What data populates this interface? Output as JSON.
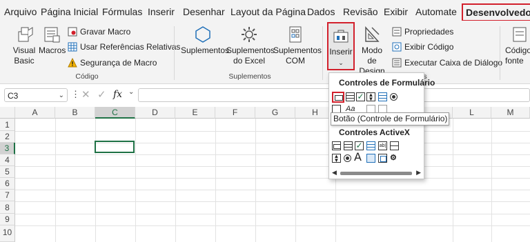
{
  "tabs": [
    "Arquivo",
    "Página Inicial",
    "Fórmulas",
    "Inserir",
    "Desenhar",
    "Layout da Página",
    "Dados",
    "Revisão",
    "Exibir",
    "Automate",
    "Desenvolvedor"
  ],
  "ribbon": {
    "codigo": {
      "visual_basic": "Visual Basic",
      "macros": "Macros",
      "gravar_macro": "Gravar Macro",
      "referencias": "Usar Referências Relativas",
      "seguranca": "Segurança de Macro",
      "group_label": "Código"
    },
    "suplementos": {
      "suplementos": "Suplementos",
      "excel": "Suplementos do Excel",
      "com": "Suplementos COM",
      "group_label": "Suplementos"
    },
    "controles": {
      "inserir": "Inserir",
      "modo_design": "Modo de Design",
      "propriedades": "Propriedades",
      "exibir_codigo": "Exibir Código",
      "executar": "Executar Caixa de Diálogo",
      "group_tail": "s"
    },
    "xml": {
      "codigo_fonte": "Código fonte"
    }
  },
  "formula_bar": {
    "name_box": "C3",
    "fx": "fx"
  },
  "columns": [
    "A",
    "B",
    "C",
    "D",
    "E",
    "F",
    "G",
    "H",
    "L",
    "M"
  ],
  "rows": [
    "1",
    "2",
    "3",
    "4",
    "5",
    "6",
    "7",
    "8",
    "9",
    "10"
  ],
  "dropdown": {
    "form_controls_header": "Controles de Formulário",
    "activex_header": "Controles ActiveX"
  },
  "tooltip": "Botão (Controle de Formulário)",
  "colors": {
    "accent_red": "#d21f2b",
    "selection_green": "#1e7145",
    "icon_blue": "#1f6fb8"
  }
}
